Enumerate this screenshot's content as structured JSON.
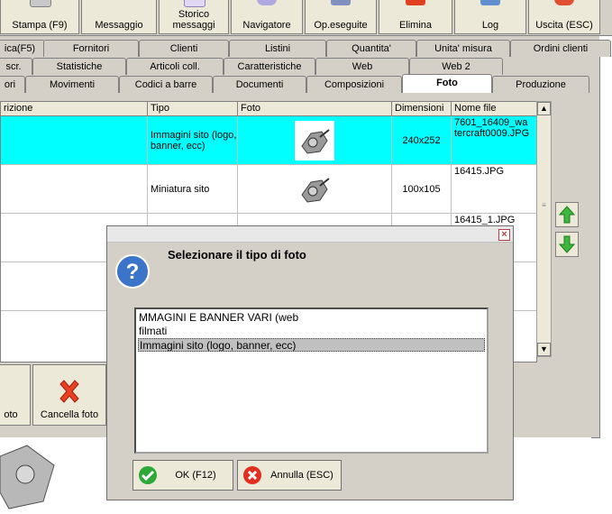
{
  "toolbar": {
    "buttons": [
      {
        "label": "Stampa (F9)",
        "icon": "printer-icon"
      },
      {
        "label": "Messaggio",
        "icon": "message-icon"
      },
      {
        "label": "Storico\nmessaggi",
        "icon": "history-icon"
      },
      {
        "label": "Navigatore",
        "icon": "navigator-icon"
      },
      {
        "label": "Op.eseguite",
        "icon": "operations-icon"
      },
      {
        "label": "Elimina",
        "icon": "delete-icon"
      },
      {
        "label": "Log",
        "icon": "log-icon"
      },
      {
        "label": "Uscita (ESC)",
        "icon": "exit-icon"
      }
    ]
  },
  "tabs": {
    "row1": [
      "ica(F5)",
      "Fornitori",
      "Clienti",
      "Listini",
      "Quantita'",
      "Unita' misura",
      "Ordini clienti"
    ],
    "row2": [
      "scr.",
      "Statistiche",
      "Articoli coll.",
      "Caratteristiche",
      "Web",
      "Web 2"
    ],
    "row3": [
      "ori",
      "Movimenti",
      "Codici a barre",
      "Documenti",
      "Composizioni",
      "Foto",
      "Produzione"
    ]
  },
  "grid": {
    "headers": [
      "rizione",
      "Tipo",
      "Foto",
      "Dimensioni",
      "Nome file"
    ],
    "rows": [
      {
        "tipo": "Immagini sito (logo, banner, ecc)",
        "dimensioni": "240x252",
        "nome_file": "7601_16409_wa\ntercraft0009.JPG"
      },
      {
        "tipo": "Miniatura sito",
        "dimensioni": "100x105",
        "nome_file": "16415.JPG"
      },
      {
        "tipo": "",
        "dimensioni": "",
        "nome_file": "16415_1.JPG"
      }
    ]
  },
  "bottom": {
    "foto_label": "oto",
    "cancel_label": "Cancella foto"
  },
  "dialog": {
    "title": "Selezionare il tipo di foto",
    "options": [
      "MMAGINI E BANNER VARI (web",
      "filmati",
      "Immagini sito (logo, banner, ecc)"
    ],
    "selected_index": 2,
    "ok_label": "OK (F12)",
    "cancel_label": "Annulla (ESC)"
  },
  "colors": {
    "selected_row": "#00ffff",
    "window_bg": "#d4d0c8",
    "ok_green": "#2ea836",
    "cancel_red": "#e03020"
  }
}
